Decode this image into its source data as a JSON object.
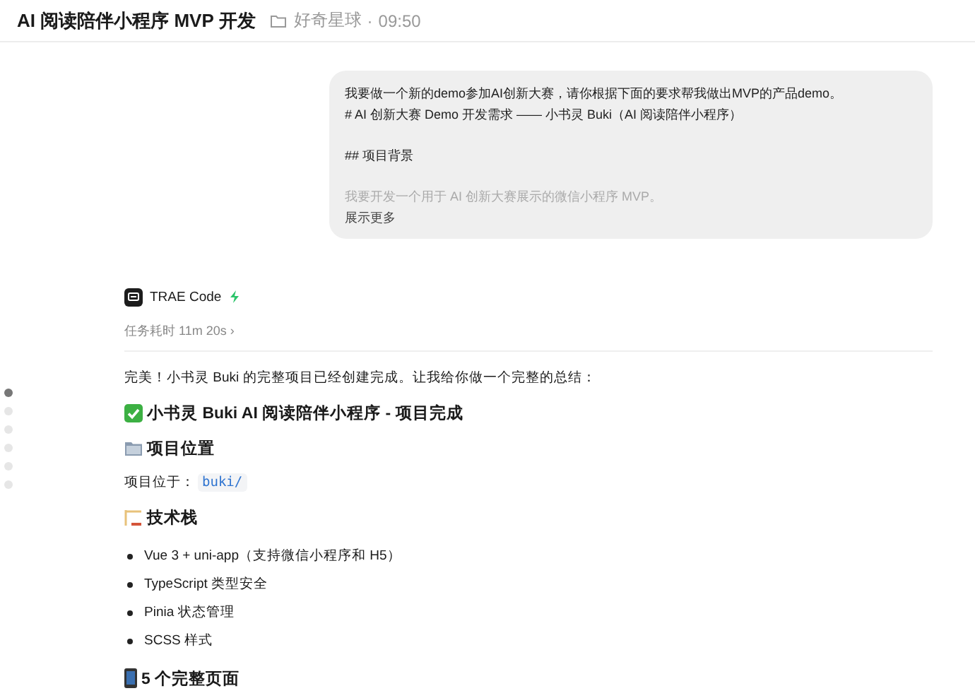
{
  "header": {
    "title": "AI 阅读陪伴小程序 MVP 开发",
    "workspace": "好奇星球",
    "time": "09:50",
    "separator": "·"
  },
  "user_message": {
    "lines": [
      {
        "kind": "text",
        "text": "我要做一个新的demo参加AI创新大赛，请你根据下面的要求帮我做出MVP的产品demo。"
      },
      {
        "kind": "text",
        "text": "# AI 创新大赛 Demo 开发需求 —— 小书灵 Buki（AI 阅读陪伴小程序）"
      },
      {
        "kind": "blank"
      },
      {
        "kind": "text",
        "text": "## 项目背景"
      },
      {
        "kind": "blank"
      },
      {
        "kind": "preview",
        "text": "我要开发一个用于 AI 创新大赛展示的微信小程序 MVP。"
      }
    ],
    "show_more": "展示更多"
  },
  "assistant": {
    "name": "TRAE Code",
    "duration": "任务耗时 11m 20s",
    "chevron": "›"
  },
  "nav_dots": [
    {
      "selected": true
    },
    {
      "selected": false
    },
    {
      "selected": false
    },
    {
      "selected": false
    },
    {
      "selected": false
    },
    {
      "selected": false
    }
  ],
  "response": [
    {
      "kind": "paragraph",
      "text": "完美！小书灵 Buki 的完整项目已经创建完成。让我给你做一个完整的总结："
    },
    {
      "kind": "completion",
      "text": "小书灵 Buki AI 阅读陪伴小程序 - 项目完成"
    },
    {
      "kind": "location",
      "text": "项目位置"
    },
    {
      "kind": "code_line",
      "text": "项目位于：",
      "code": "buki/"
    },
    {
      "kind": "stack",
      "text": "技术栈"
    },
    {
      "kind": "bullets",
      "items": [
        "Vue 3 + uni-app（支持微信小程序和 H5）",
        "TypeScript 类型安全",
        "Pinia 状态管理",
        "SCSS 样式"
      ]
    },
    {
      "kind": "pages",
      "text": "5 个完整页面"
    }
  ]
}
